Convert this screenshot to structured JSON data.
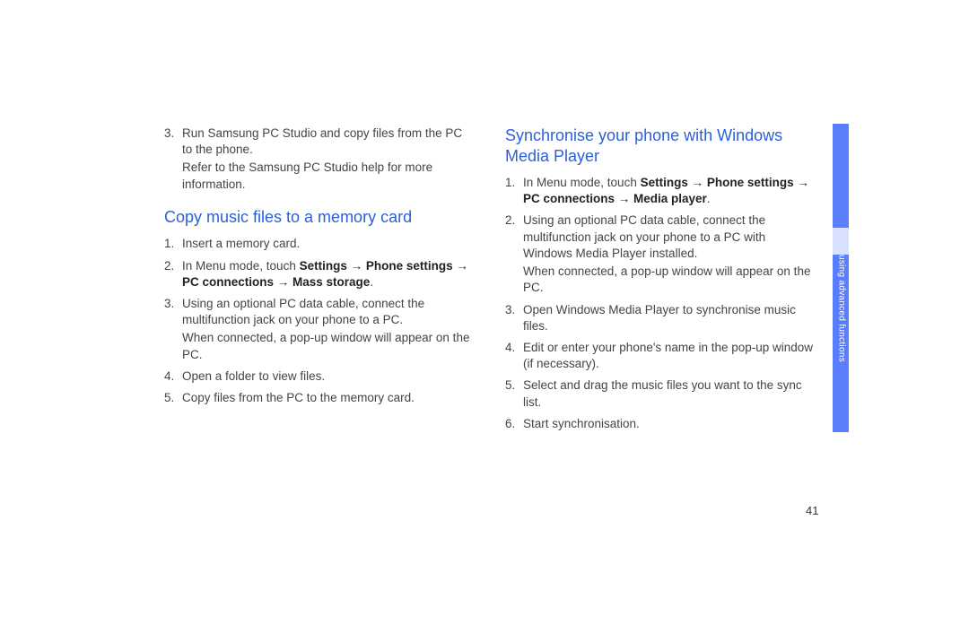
{
  "left": {
    "preStep": {
      "num": "3.",
      "line1": "Run Samsung PC Studio and copy files from the PC to the phone.",
      "line2": "Refer to the Samsung PC Studio help for more information."
    },
    "heading": "Copy music files to a memory card",
    "steps": [
      {
        "num": "1.",
        "body": "Insert a memory card."
      },
      {
        "num": "2.",
        "prefix": "In Menu mode, touch ",
        "bold": "Settings → Phone settings → PC connections → Mass storage",
        "suffix": "."
      },
      {
        "num": "3.",
        "body": "Using an optional PC data cable, connect the multifunction jack on your phone to a PC.",
        "sub": "When connected, a pop-up window will appear on the PC."
      },
      {
        "num": "4.",
        "body": "Open a folder to view files."
      },
      {
        "num": "5.",
        "body": "Copy files from the PC to the memory card."
      }
    ]
  },
  "right": {
    "heading": "Synchronise your phone with Windows Media Player",
    "steps": [
      {
        "num": "1.",
        "prefix": "In Menu mode, touch ",
        "bold": "Settings → Phone settings → PC connections → Media player",
        "suffix": "."
      },
      {
        "num": "2.",
        "body": "Using an optional PC data cable, connect the multifunction jack on your phone to a PC with Windows Media Player installed.",
        "sub": "When connected, a pop-up window will appear on the PC."
      },
      {
        "num": "3.",
        "body": "Open Windows Media Player to synchronise music files."
      },
      {
        "num": "4.",
        "body": "Edit or enter your phone's name in the pop-up window (if necessary)."
      },
      {
        "num": "5.",
        "body": "Select and drag the music files you want to the sync list."
      },
      {
        "num": "6.",
        "body": "Start synchronisation."
      }
    ]
  },
  "sideLabel": "using advanced functions",
  "pageNumber": "41"
}
